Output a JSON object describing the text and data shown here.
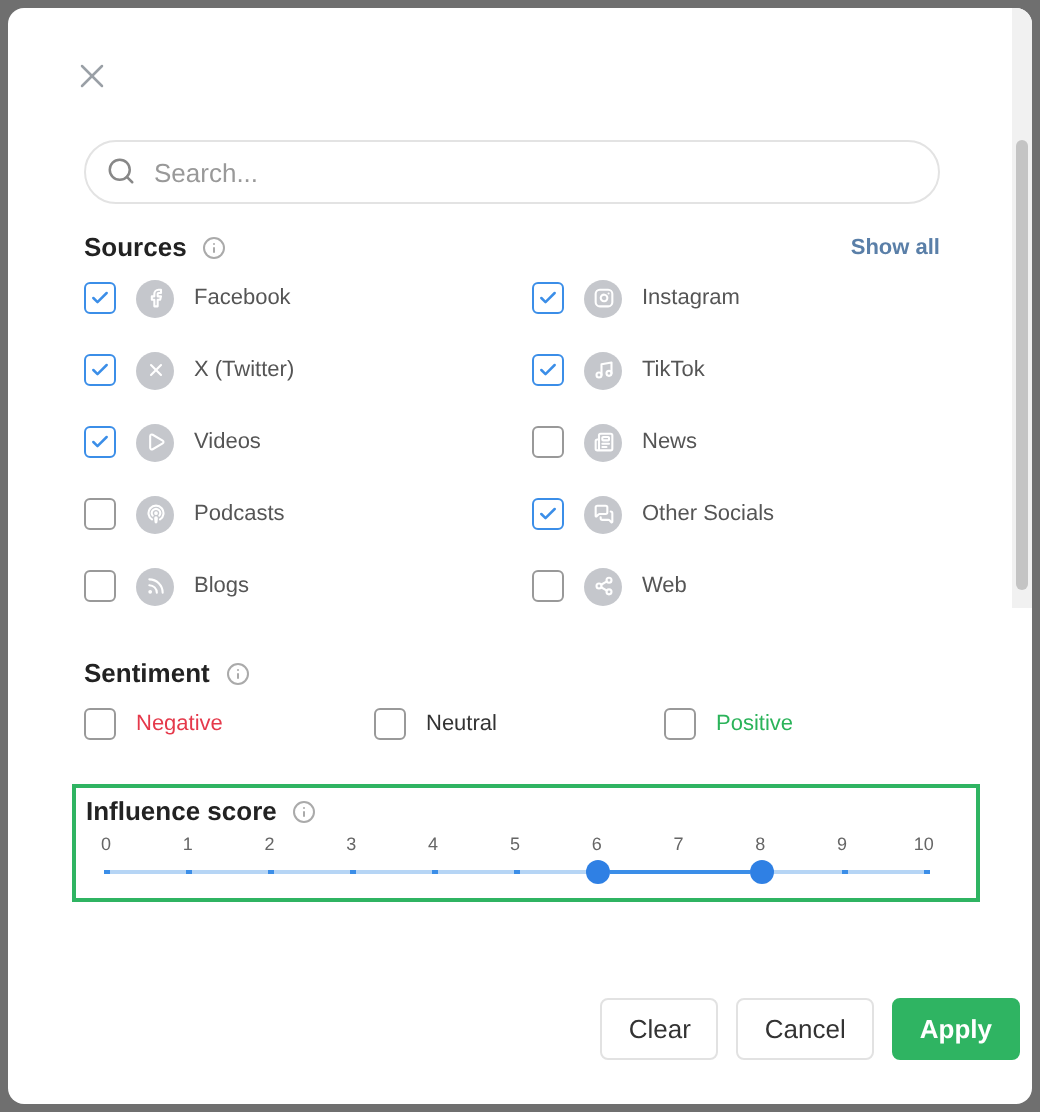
{
  "search": {
    "placeholder": "Search..."
  },
  "sources": {
    "title": "Sources",
    "show_all": "Show all",
    "items": [
      {
        "label": "Facebook",
        "checked": true
      },
      {
        "label": "Instagram",
        "checked": true
      },
      {
        "label": "X (Twitter)",
        "checked": true
      },
      {
        "label": "TikTok",
        "checked": true
      },
      {
        "label": "Videos",
        "checked": true
      },
      {
        "label": "News",
        "checked": false
      },
      {
        "label": "Podcasts",
        "checked": false
      },
      {
        "label": "Other Socials",
        "checked": true
      },
      {
        "label": "Blogs",
        "checked": false
      },
      {
        "label": "Web",
        "checked": false
      }
    ]
  },
  "sentiment": {
    "title": "Sentiment",
    "items": [
      {
        "label": "Negative",
        "checked": false,
        "color": "#e5394b"
      },
      {
        "label": "Neutral",
        "checked": false,
        "color": "#333333"
      },
      {
        "label": "Positive",
        "checked": false,
        "color": "#2bb35a"
      }
    ]
  },
  "influence": {
    "title": "Influence score",
    "ticks": [
      "0",
      "1",
      "2",
      "3",
      "4",
      "5",
      "6",
      "7",
      "8",
      "9",
      "10"
    ],
    "thumbs": [
      {
        "level": 0.6
      },
      {
        "level": 0.8
      }
    ]
  },
  "buttons": [
    {
      "label": "Clear",
      "kind": "secondary"
    },
    {
      "label": "Cancel",
      "kind": "secondary"
    },
    {
      "label": "Apply",
      "kind": "primary"
    }
  ]
}
